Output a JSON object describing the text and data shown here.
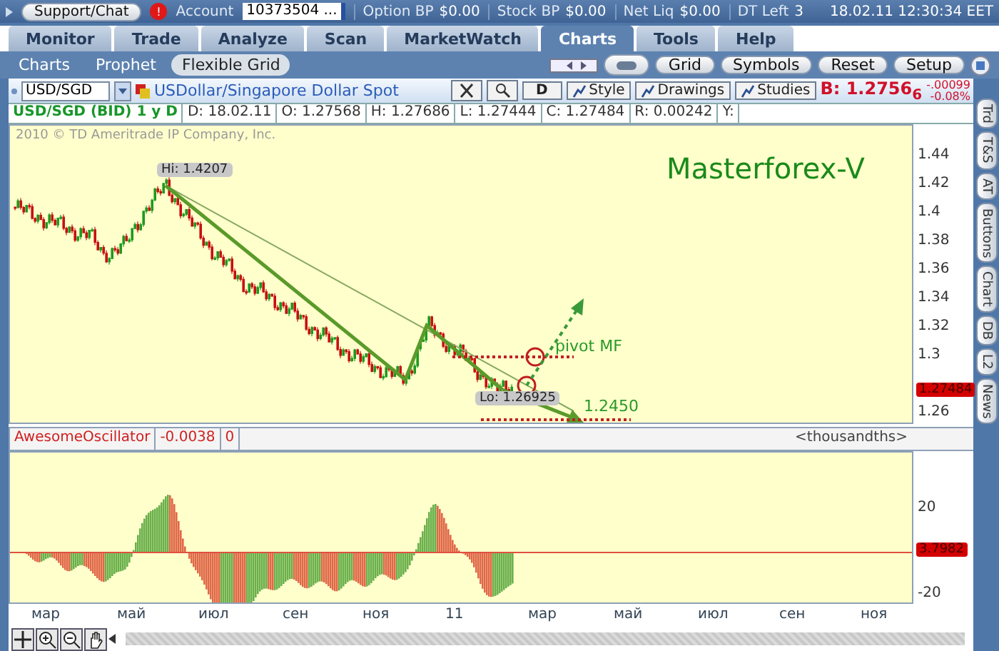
{
  "top_bar": {
    "support_button": "Support/Chat",
    "alert_badge": "!",
    "account_label": "Account",
    "account_value": "10373504 ...",
    "stats": [
      {
        "label": "Option BP",
        "value": "$0.00"
      },
      {
        "label": "Stock BP",
        "value": "$0.00"
      },
      {
        "label": "Net Liq",
        "value": "$0.00"
      },
      {
        "label": "DT Left",
        "value": "3"
      }
    ],
    "datetime": "18.02.11 12:30:34 EET"
  },
  "tabs": [
    {
      "label": "Monitor",
      "selected": false
    },
    {
      "label": "Trade",
      "selected": false
    },
    {
      "label": "Analyze",
      "selected": false
    },
    {
      "label": "Scan",
      "selected": false
    },
    {
      "label": "MarketWatch",
      "selected": false
    },
    {
      "label": "Charts",
      "selected": true
    },
    {
      "label": "Tools",
      "selected": false
    },
    {
      "label": "Help",
      "selected": false
    }
  ],
  "subtabs": [
    {
      "label": "Charts",
      "selected": false
    },
    {
      "label": "Prophet",
      "selected": false
    },
    {
      "label": "Flexible Grid",
      "selected": true
    }
  ],
  "toolbar_buttons": [
    "Grid",
    "Symbols",
    "Reset",
    "Setup"
  ],
  "chart_toolbar": {
    "symbol": "USD/SGD",
    "description": "USDollar/Singapore Dollar Spot",
    "aggregation": "D",
    "buttons": [
      "Style",
      "Drawings",
      "Studies"
    ],
    "bid": "B: 1.2756$_{6}$",
    "change": "-.00099",
    "change_pct": "-0.08%"
  },
  "info": {
    "title": "USD/SGD (BID) 1 y D",
    "fields": [
      "D: 18.02.11",
      "O: 1.27568",
      "H: 1.27686",
      "L: 1.27444",
      "C: 1.27484",
      "R: 0.00242",
      "Y:"
    ]
  },
  "price_chart": {
    "copyright": "2010 © TD Ameritrade IP Company, Inc.",
    "headline": "Masterforex-V",
    "high_label": "Hi: 1.4207",
    "low_label": "Lo: 1.26925",
    "pivot_label": "pivot MF",
    "target_label": "1.2450",
    "y_ticks": [
      "1.44",
      "1.42",
      "1.4",
      "1.38",
      "1.36",
      "1.34",
      "1.32",
      "1.3",
      "1.26"
    ],
    "last_price": "1.27484"
  },
  "oscillator": {
    "name": "AwesomeOscillator",
    "value": "-0.0038",
    "param": "0",
    "units": "<thousandths>",
    "y_ticks": [
      "20",
      "-20"
    ],
    "last_value": "3.7982"
  },
  "x_axis": [
    "мар",
    "май",
    "июл",
    "сен",
    "ноя",
    "11",
    "мар",
    "май",
    "июл",
    "сен",
    "ноя"
  ],
  "side_tabs": [
    "Trd",
    "T&S",
    "AT",
    "Buttons",
    "Chart",
    "DB",
    "L2",
    "News"
  ]
}
